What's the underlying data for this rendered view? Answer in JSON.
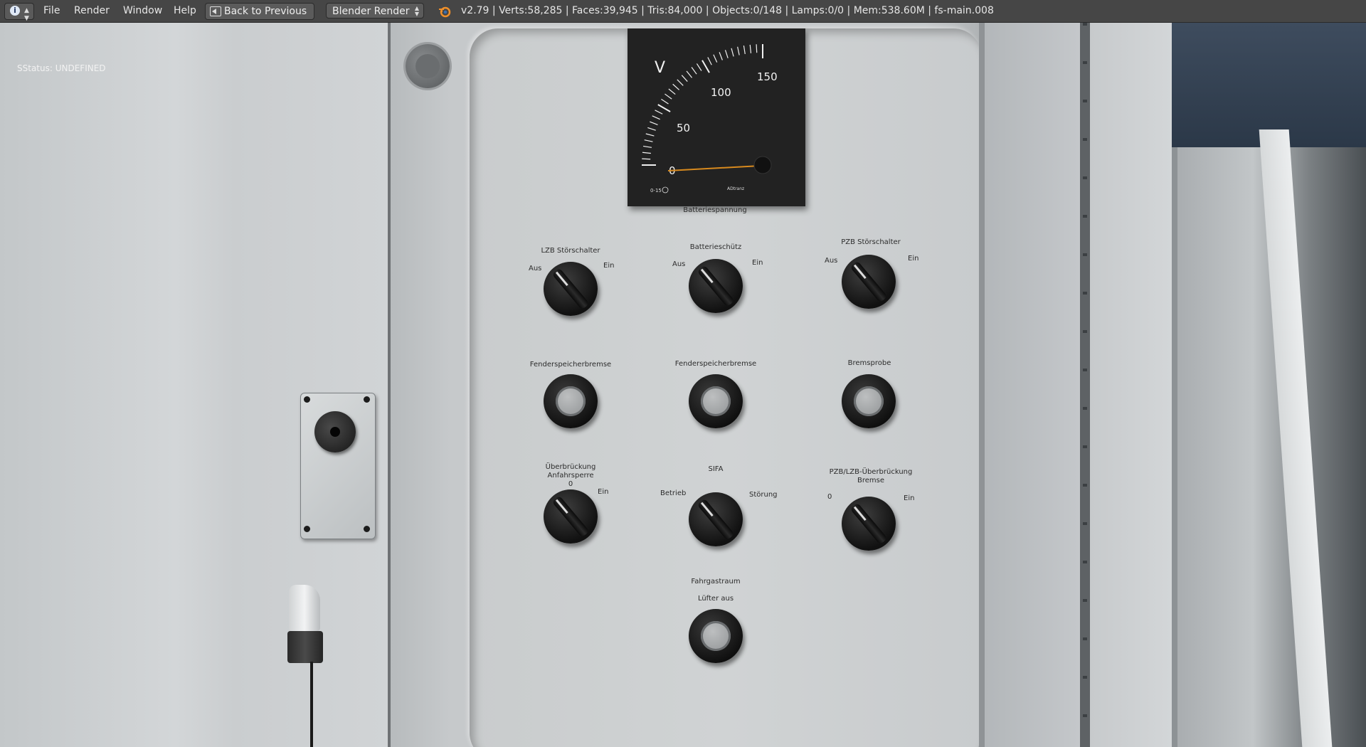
{
  "topbar": {
    "info_icon": "info-icon",
    "menu": [
      "File",
      "Render",
      "Window",
      "Help"
    ],
    "back_button": "Back to Previous",
    "render_engine": "Blender Render",
    "stats": "v2.79 | Verts:58,285 | Faces:39,945 | Tris:84,000 | Objects:0/148 | Lamps:0/0 | Mem:538.60M | fs-main.008"
  },
  "viewport": {
    "status": "SStatus: UNDEFINED"
  },
  "meter": {
    "unit": "V",
    "scale": [
      "0",
      "50",
      "100",
      "150"
    ],
    "range_min": 0,
    "range_max": 150,
    "needle_value": 0,
    "small_left": "0-15",
    "small_right": "ADtranz",
    "caption": "Batteriespannung",
    "needle_color": "#d88a1e"
  },
  "controls": {
    "lzb": {
      "title": "LZB Störschalter",
      "left": "Aus",
      "right": "Ein"
    },
    "batt": {
      "title": "Batterieschütz",
      "left": "Aus",
      "right": "Ein"
    },
    "pzb": {
      "title": "PZB Störschalter",
      "left": "Aus",
      "right": "Ein"
    },
    "fsb1": {
      "title": "Fenderspeicherbremse"
    },
    "fsb2": {
      "title": "Fenderspeicherbremse"
    },
    "bremsprobe": {
      "title": "Bremsprobe"
    },
    "ueb": {
      "title1": "Überbrückung",
      "title2": "Anfahrsperre",
      "title3": "0",
      "right": "Ein"
    },
    "sifa": {
      "title": "SIFA",
      "left": "Betrieb",
      "right": "Störung"
    },
    "pzblzb": {
      "title1": "PZB/LZB-Überbrückung",
      "title2": "Bremse",
      "left": "0",
      "right": "Ein"
    },
    "luefter": {
      "title1": "Fahrgastraum",
      "title2": "Lüfter aus"
    }
  }
}
